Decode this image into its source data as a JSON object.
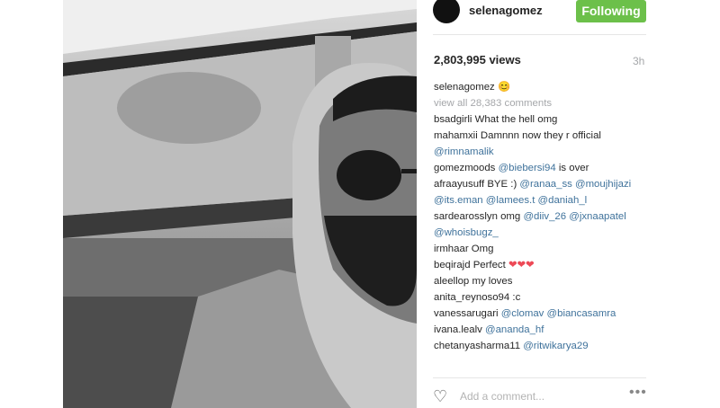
{
  "post": {
    "username": "selenagomez",
    "follow_label": "Following",
    "views": "2,803,995 views",
    "time": "3h",
    "caption_user": "selenagomez",
    "caption_text": "😊",
    "view_all": "view all 28,383 comments"
  },
  "comments": [
    {
      "user": "bsadgirli",
      "text": "What the hell omg",
      "mentions": ""
    },
    {
      "user": "mahamxii",
      "text": "Damnnn now they r official",
      "mentions": "@rimnamalik"
    },
    {
      "user": "gomezmoods",
      "text": "",
      "mentions": "@biebersi94",
      "tail": "is over"
    },
    {
      "user": "afraayusuff",
      "text": "BYE :)",
      "mentions": "@ranaa_ss @moujhijazi @its.eman @lamees.t @daniah_l"
    },
    {
      "user": "sardearosslyn",
      "text": "omg",
      "mentions": "@diiv_26 @jxnaapatel @whoisbugz_"
    },
    {
      "user": "irmhaar",
      "text": "Omg",
      "mentions": ""
    },
    {
      "user": "beqirajd",
      "text": "Perfect",
      "mentions": "",
      "hearts": "❤❤❤"
    },
    {
      "user": "aleellop",
      "text": "my loves",
      "mentions": ""
    },
    {
      "user": "anita_reynoso94",
      "text": ":c",
      "mentions": ""
    },
    {
      "user": "vanessarugari",
      "text": "",
      "mentions": "@clomav @biancasamra"
    },
    {
      "user": "ivana.lealv",
      "text": "",
      "mentions": "@ananda_hf"
    },
    {
      "user": "chetanyasharma11",
      "text": "",
      "mentions": "@ritwikarya29"
    }
  ],
  "footer": {
    "placeholder": "Add a comment...",
    "heart_icon": "heart-outline-icon",
    "more_icon": "ellipsis-icon"
  },
  "colors": {
    "follow": "#6cc04a",
    "mention": "#3f729b",
    "muted": "#a5a7aa"
  }
}
